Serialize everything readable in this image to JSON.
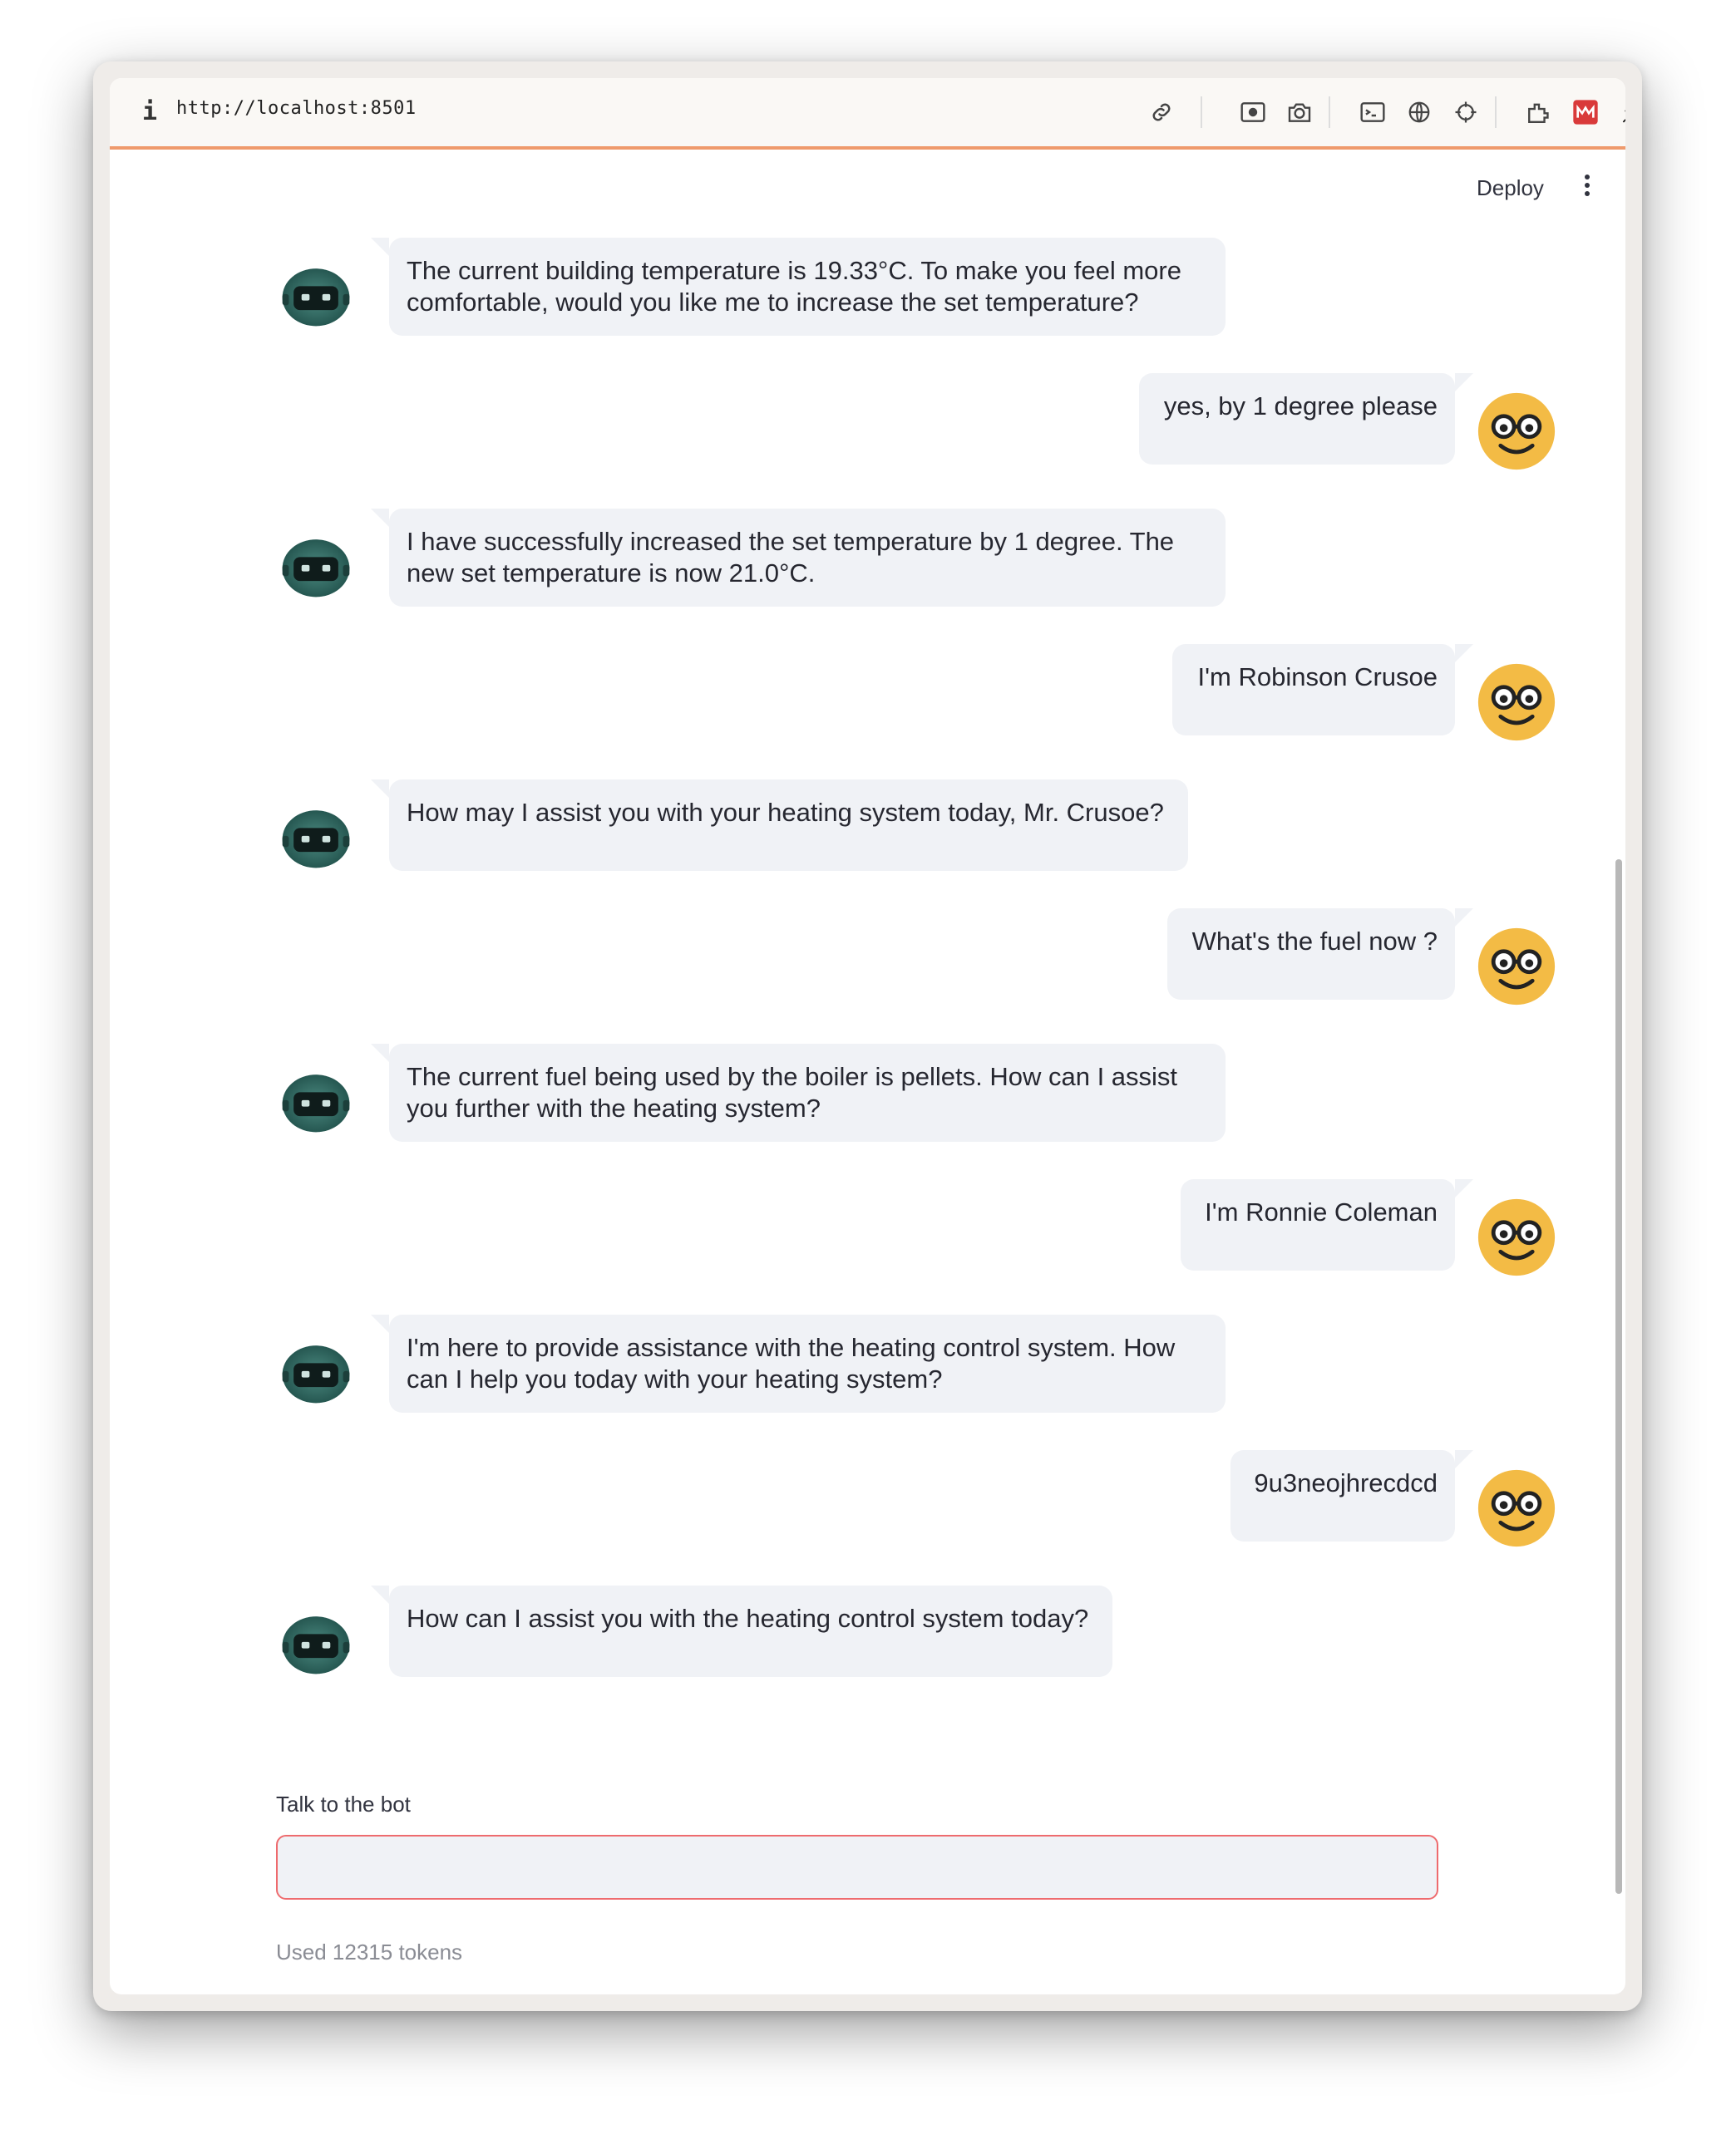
{
  "browser": {
    "url": "http://localhost:8501",
    "info_icon": "i",
    "toolbar_icons": [
      "link-icon",
      "screenshot-icon",
      "camera-icon",
      "terminal-icon",
      "globe-icon",
      "crosshair-icon",
      "extensions-icon",
      "app-red-icon",
      "pin-icon",
      "sidebar-icon"
    ]
  },
  "app": {
    "deploy_label": "Deploy",
    "menu_icon": "vertical-dots-icon"
  },
  "chat": {
    "messages": [
      {
        "role": "bot",
        "text": "The current building temperature is 19.33°C. To make you feel more comfortable, would you like me to increase the set temperature?"
      },
      {
        "role": "user",
        "text": "yes, by 1 degree please"
      },
      {
        "role": "bot",
        "text": "I have successfully increased the set temperature by 1 degree. The new set temperature is now 21.0°C."
      },
      {
        "role": "user",
        "text": "I'm Robinson Crusoe"
      },
      {
        "role": "bot",
        "text": "How may I assist you with your heating system today, Mr. Crusoe?"
      },
      {
        "role": "user",
        "text": "What's the fuel now ?"
      },
      {
        "role": "bot",
        "text": "The current fuel being used by the boiler is pellets. How can I assist you further with the heating system?"
      },
      {
        "role": "user",
        "text": "I'm Ronnie Coleman"
      },
      {
        "role": "bot",
        "text": "I'm here to provide assistance with the heating control system. How can I help you today with your heating system?"
      },
      {
        "role": "user",
        "text": "9u3neojhrecdcd"
      },
      {
        "role": "bot",
        "text": "How can I assist you with the heating control system today?"
      }
    ]
  },
  "input": {
    "label": "Talk to the bot",
    "value": "",
    "placeholder": ""
  },
  "footer": {
    "tokens_text": "Used 12315 tokens"
  },
  "colors": {
    "accent_border": "#ee6b6e",
    "bubble_bg": "#f0f2f6",
    "user_avatar": "#f3bb45",
    "bot_avatar": "#2f6f67"
  }
}
